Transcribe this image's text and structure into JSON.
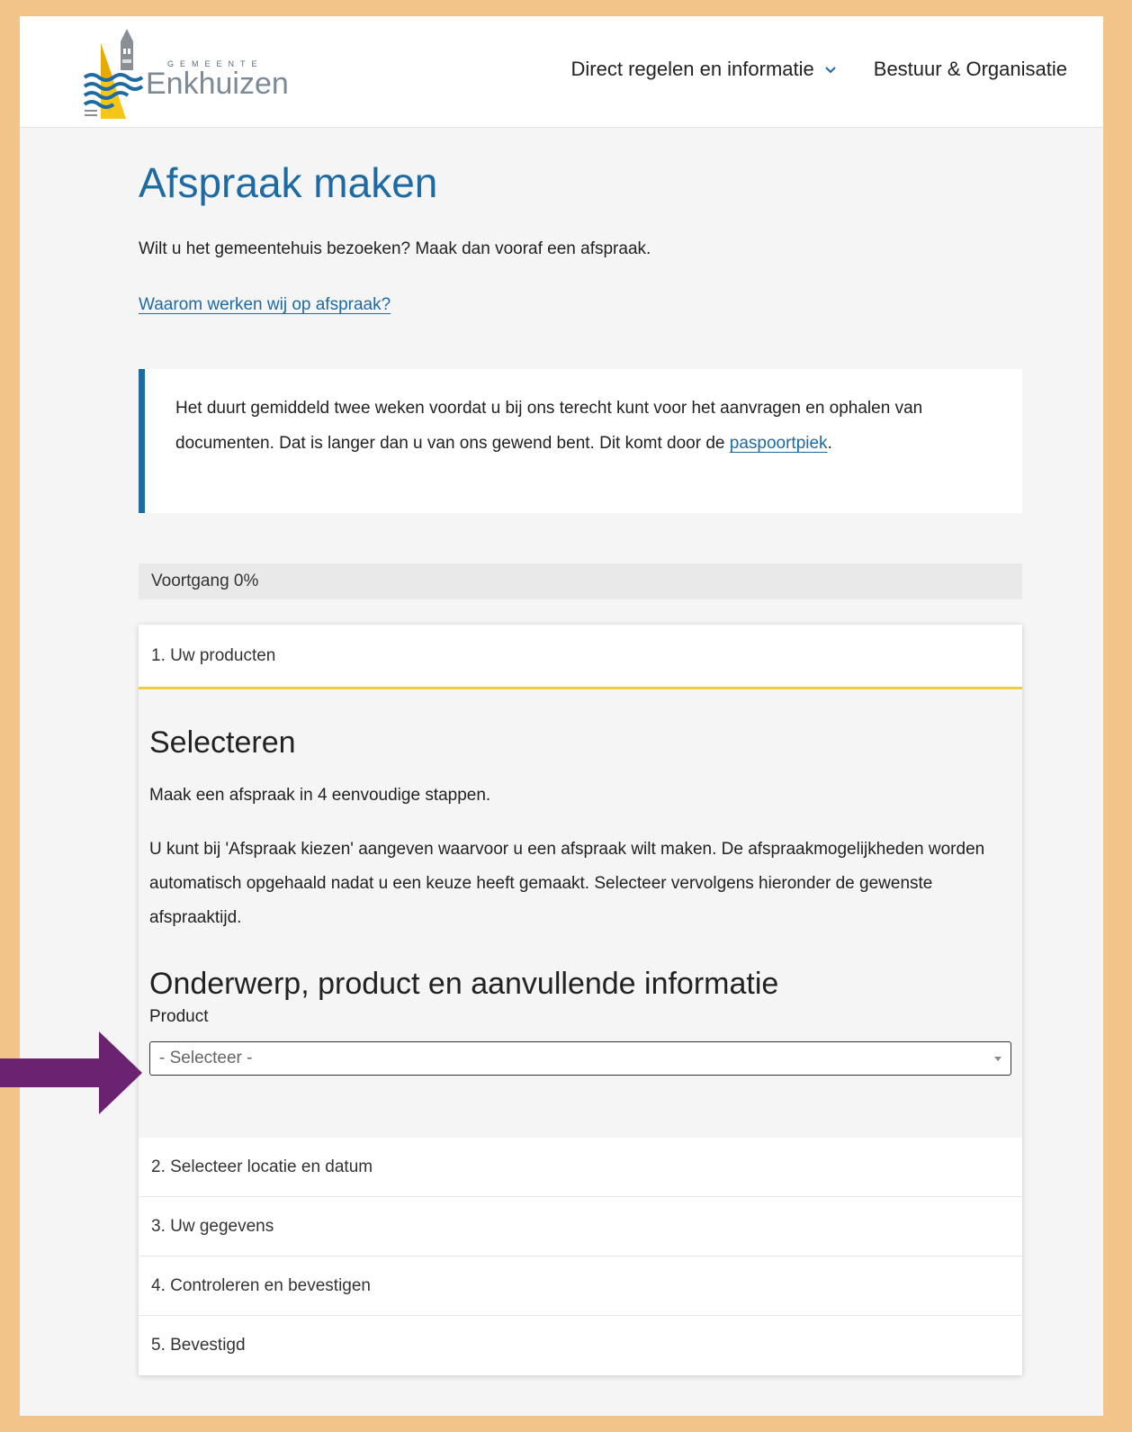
{
  "header": {
    "logo": {
      "small": "GEMEENTE",
      "name": "Enkhuizen"
    },
    "nav": [
      {
        "label": "Direct regelen en informatie",
        "has_dropdown": true
      },
      {
        "label": "Bestuur & Organisatie",
        "has_dropdown": false
      }
    ]
  },
  "main": {
    "title": "Afspraak maken",
    "intro": "Wilt u het gemeentehuis bezoeken? Maak dan vooraf een afspraak.",
    "why_link": "Waarom werken wij op afspraak?",
    "notice": {
      "text_before": "Het duurt gemiddeld twee weken voordat u bij ons terecht kunt voor het aanvragen en ophalen van documenten. Dat is langer dan u van ons gewend bent. Dit komt door de ",
      "link": "paspoortpiek",
      "text_after": "."
    },
    "progress": {
      "label": "Voortgang 0%",
      "value_percent": 0
    },
    "steps": [
      {
        "label": "1. Uw producten",
        "active": true
      },
      {
        "label": "2. Selecteer locatie en datum",
        "active": false
      },
      {
        "label": "3. Uw gegevens",
        "active": false
      },
      {
        "label": "4. Controleren en bevestigen",
        "active": false
      },
      {
        "label": "5. Bevestigd",
        "active": false
      }
    ],
    "step1": {
      "heading": "Selecteren",
      "p1": "Maak een afspraak in 4 eenvoudige stappen.",
      "p2": "U kunt bij 'Afspraak kiezen' aangeven waarvoor u een afspraak wilt maken. De afspraakmogelijkheden worden automatisch opgehaald nadat u een keuze heeft gemaakt. Selecteer vervolgens hieronder de gewenste afspraaktijd.",
      "section_heading": "Onderwerp, product en aanvullende informatie",
      "product_label": "Product",
      "product_select_value": "- Selecteer -"
    }
  },
  "colors": {
    "frame_border": "#f3c48a",
    "accent_blue": "#1e6aa3",
    "active_step_underline": "#f2cc3c",
    "annotation_arrow": "#6b2270"
  },
  "icons": [
    "logo-enkhuizen",
    "chevron-down-icon",
    "select-caret-icon",
    "annotation-arrow"
  ]
}
